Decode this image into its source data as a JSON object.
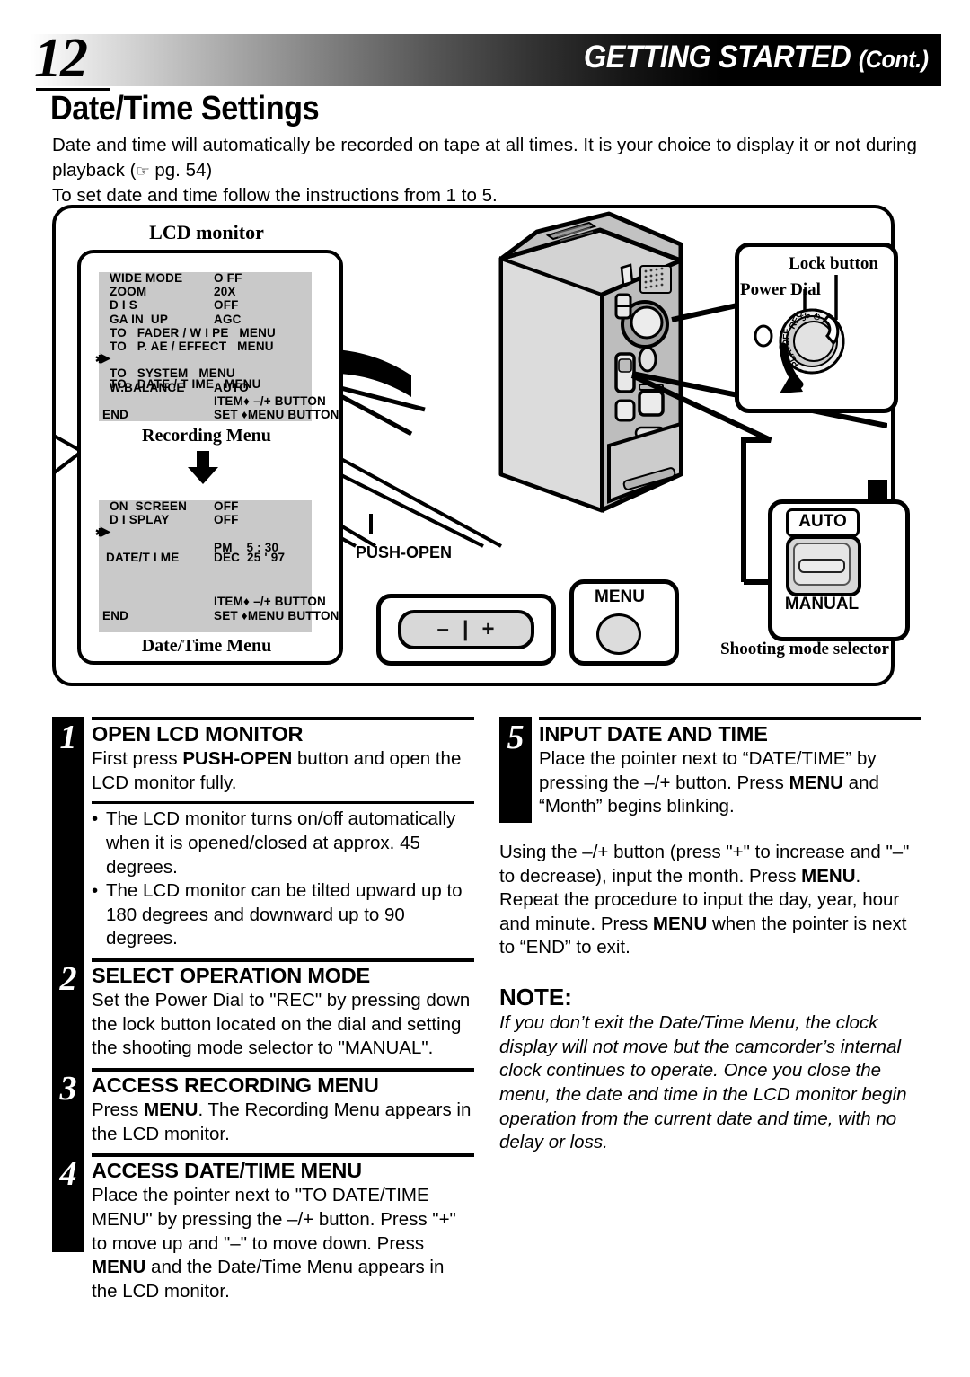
{
  "header": {
    "page_number": "12",
    "title": "GETTING STARTED",
    "title_cont": "(Cont.)"
  },
  "section": {
    "title": "Date/Time Settings",
    "intro_line1": "Date and time will automatically be recorded on tape at all times. It is your choice to display it or not during",
    "intro_line2_pre": "playback (",
    "intro_hand_icon": "☞",
    "intro_line2_post": " pg. 54)",
    "intro_line3": "To set date and time follow the instructions from 1 to 5."
  },
  "diagram": {
    "lcd_monitor_label": "LCD monitor",
    "recording_menu_caption": "Recording Menu",
    "date_time_menu_caption": "Date/Time Menu",
    "recording_menu": {
      "rows": [
        {
          "label": "WIDE MODE",
          "value": "O FF"
        },
        {
          "label": "ZOOM",
          "value": "20X"
        },
        {
          "label": "D I S",
          "value": "OFF"
        },
        {
          "label": "GA IN  UP",
          "value": "AGC"
        },
        {
          "full": "TO   FADER / W I PE   MENU"
        },
        {
          "full": "TO   P. AE / EFFECT   MENU"
        },
        {
          "full": "TO   DATE / T IME   MENU",
          "pointer": true
        },
        {
          "full": "TO   SYSTEM   MENU"
        },
        {
          "label": "W.BALANCE",
          "value": "AUTO"
        }
      ],
      "footer_item": "ITEM♦ –/+ BUTTON",
      "footer_end_left": "END",
      "footer_end_right": "SET ♦MENU BUTTON"
    },
    "date_time_menu": {
      "rows": [
        {
          "label": "ON  SCREEN",
          "value": "OFF"
        },
        {
          "label": "D I SPLAY",
          "value": "OFF"
        },
        {
          "label": "DATE/T I ME",
          "value": "DEC  25 ' 97",
          "pointer": true
        },
        {
          "label": "",
          "value": "PM    5 : 30"
        }
      ],
      "footer_item": "ITEM♦ –/+ BUTTON",
      "footer_end_left": "END",
      "footer_end_right": "SET ♦MENU BUTTON"
    },
    "callouts": {
      "lock_button": "Lock button",
      "power_dial": "Power Dial",
      "push_open": "PUSH-OPEN",
      "menu_button": "MENU",
      "minus": "–",
      "bar": "|",
      "plus": "+",
      "auto": "AUTO",
      "manual": "MANUAL",
      "shooting_mode_selector": "Shooting mode selector"
    },
    "power_dial_positions": [
      "REC",
      "5S",
      "⏻",
      "OFF",
      "PLAY"
    ]
  },
  "steps_left": [
    {
      "num": "1",
      "head": "OPEN LCD MONITOR",
      "body_pre": "First press ",
      "body_bold": "PUSH-OPEN",
      "body_post": " button and open the LCD monitor fully.",
      "bullets": [
        "The LCD monitor turns on/off automatically when it is opened/closed at approx. 45 degrees.",
        "The LCD monitor can be tilted upward up to 180 degrees and downward up to 90 degrees."
      ]
    },
    {
      "num": "2",
      "head": "SELECT OPERATION MODE",
      "body": "Set the Power Dial to \"REC\" by pressing down the lock button located on the dial and setting the shooting mode selector to \"MANUAL\"."
    },
    {
      "num": "3",
      "head": "ACCESS RECORDING MENU",
      "body_pre": "Press ",
      "body_bold": "MENU",
      "body_post": ". The Recording Menu appears in the LCD monitor."
    },
    {
      "num": "4",
      "head": "ACCESS DATE/TIME MENU",
      "body_pre": "Place the pointer next to \"TO DATE/TIME MENU\" by pressing the –/+ button. Press \"+\" to move up and \"–\" to move down. Press ",
      "body_bold": "MENU",
      "body_post": " and the Date/Time Menu appears in the LCD monitor."
    }
  ],
  "steps_right": [
    {
      "num": "5",
      "head": "INPUT DATE AND TIME",
      "body_pre": "Place the pointer next to “DATE/TIME” by pressing the –/+ button. Press ",
      "body_bold": "MENU",
      "body_post": " and “Month” begins blinking."
    }
  ],
  "right_paragraph": {
    "pre": "Using the –/+ button (press \"+\" to increase and \"–\" to decrease), input the month. Press ",
    "bold1": "MENU",
    "mid": ". Repeat the procedure to input the day, year, hour and minute. Press ",
    "bold2": "MENU",
    "post": " when the pointer is next to “END” to exit."
  },
  "note": {
    "head": "NOTE:",
    "body": "If you don’t exit the Date/Time Menu, the clock display will not move but the camcorder’s internal clock continues to operate. Once you close the menu, the date and time in the LCD monitor begin operation from the current date and time, with no delay or loss."
  }
}
